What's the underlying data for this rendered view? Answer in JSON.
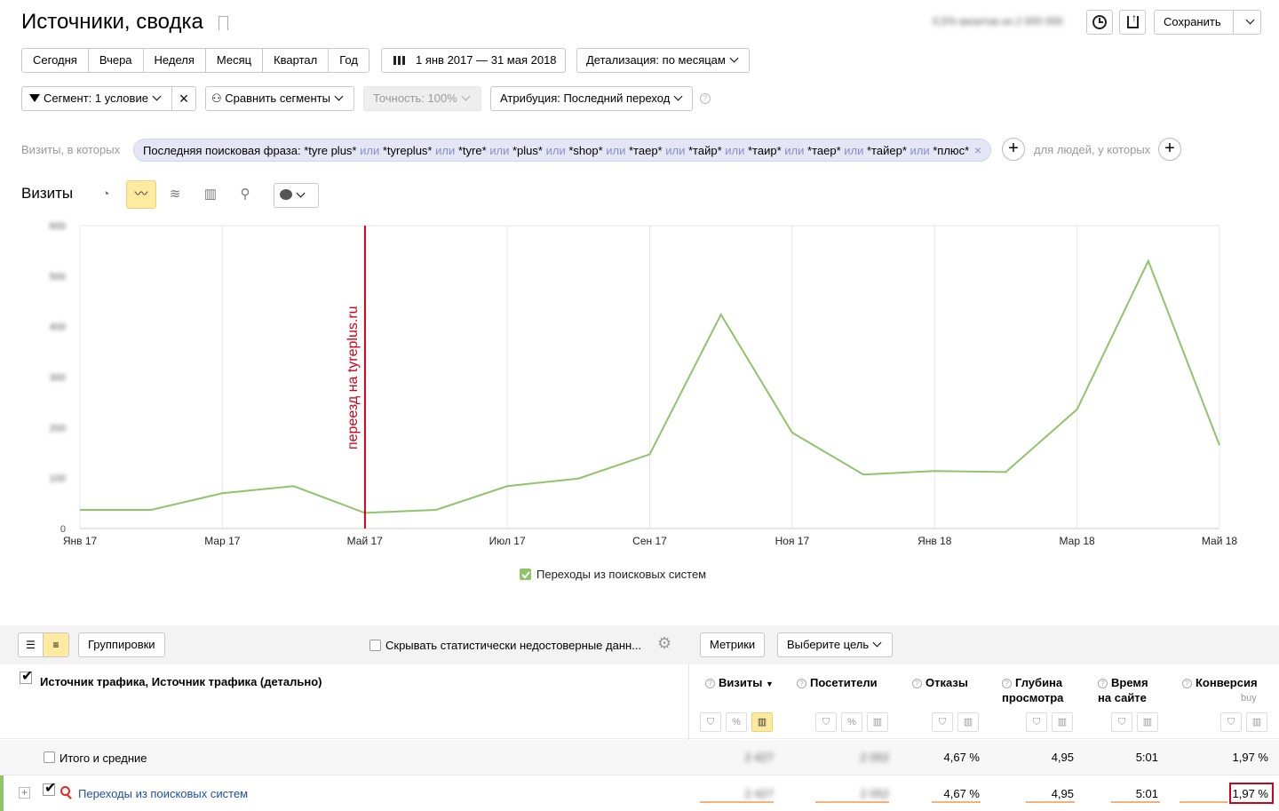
{
  "page": {
    "title": "Источники, сводка",
    "visits_summary": "0,5% визитов из 2 000 000",
    "save_label": "Сохранить"
  },
  "periods": [
    "Сегодня",
    "Вчера",
    "Неделя",
    "Месяц",
    "Квартал",
    "Год"
  ],
  "date_range": "1 янв 2017 — 31 мая 2018",
  "detail": "Детализация: по месяцам",
  "filters": {
    "segment": "Сегмент: 1 условие",
    "compare": "Сравнить сегменты",
    "accuracy": "Точность: 100%",
    "attribution": "Атрибуция: Последний переход"
  },
  "condition": {
    "prefix": "Визиты, в которых",
    "chip_label": "Последняя поисковая фраза:",
    "terms": [
      "*tyre plus*",
      "*tyreplus*",
      "*tyre*",
      "*plus*",
      "*shop*",
      "*таер*",
      "*тайр*",
      "*таир*",
      "*таер*",
      "*тайер*",
      "*плюс*"
    ],
    "or": "или",
    "people_label": "для людей, у которых"
  },
  "chart_header": {
    "title": "Визиты"
  },
  "chart_data": {
    "type": "line",
    "title": "",
    "x": [
      "Янв 17",
      "Фев 17",
      "Мар 17",
      "Апр 17",
      "Май 17",
      "Июн 17",
      "Июл 17",
      "Авг 17",
      "Сен 17",
      "Окт 17",
      "Ноя 17",
      "Дек 17",
      "Янв 18",
      "Фев 18",
      "Мар 18",
      "Апр 18",
      "Май 18"
    ],
    "x_tick_labels": [
      "Янв 17",
      "Мар 17",
      "Май 17",
      "Июл 17",
      "Сен 17",
      "Ноя 17",
      "Янв 18",
      "Мар 18",
      "Май 18"
    ],
    "series": [
      {
        "name": "Переходы из поисковых систем",
        "color": "#8fc46b",
        "values": [
          37,
          37,
          70,
          84,
          31,
          37,
          84,
          99,
          147,
          424,
          190,
          107,
          114,
          112,
          236,
          530,
          165
        ]
      }
    ],
    "y_tick_labels": [
      "0",
      "100",
      "200",
      "300",
      "400",
      "500",
      "600"
    ],
    "ylim": [
      0,
      600
    ],
    "annotation": {
      "text": "переезд на tyreplus.ru",
      "x_index": 5,
      "color": "#d0021b"
    },
    "legend_position": "bottom-center",
    "grid": true
  },
  "table": {
    "groupings_label": "Группировки",
    "hide_label": "Скрывать статистически недостоверные данн...",
    "metrics_label": "Метрики",
    "goal_label": "Выберите цель",
    "dimension_header": "Источник трафика, Источник трафика (детально)",
    "columns": [
      {
        "label": "Визиты",
        "line2": "",
        "sub": ""
      },
      {
        "label": "Посетители",
        "line2": "",
        "sub": ""
      },
      {
        "label": "Отказы",
        "line2": "",
        "sub": ""
      },
      {
        "label": "Глубина",
        "line2": "просмотра",
        "sub": ""
      },
      {
        "label": "Время",
        "line2": "на сайте",
        "sub": ""
      },
      {
        "label": "Конверсия",
        "line2": "",
        "sub": "buy"
      }
    ],
    "totals": {
      "label": "Итого и средние",
      "values": [
        "2 427",
        "2 052",
        "4,67 %",
        "4,95",
        "5:01",
        "1,97 %"
      ]
    },
    "rows": [
      {
        "label": "Переходы из поисковых систем",
        "values": [
          "2 427",
          "2 052",
          "4,67 %",
          "4,95",
          "5:01",
          "1,97 %"
        ]
      }
    ]
  }
}
